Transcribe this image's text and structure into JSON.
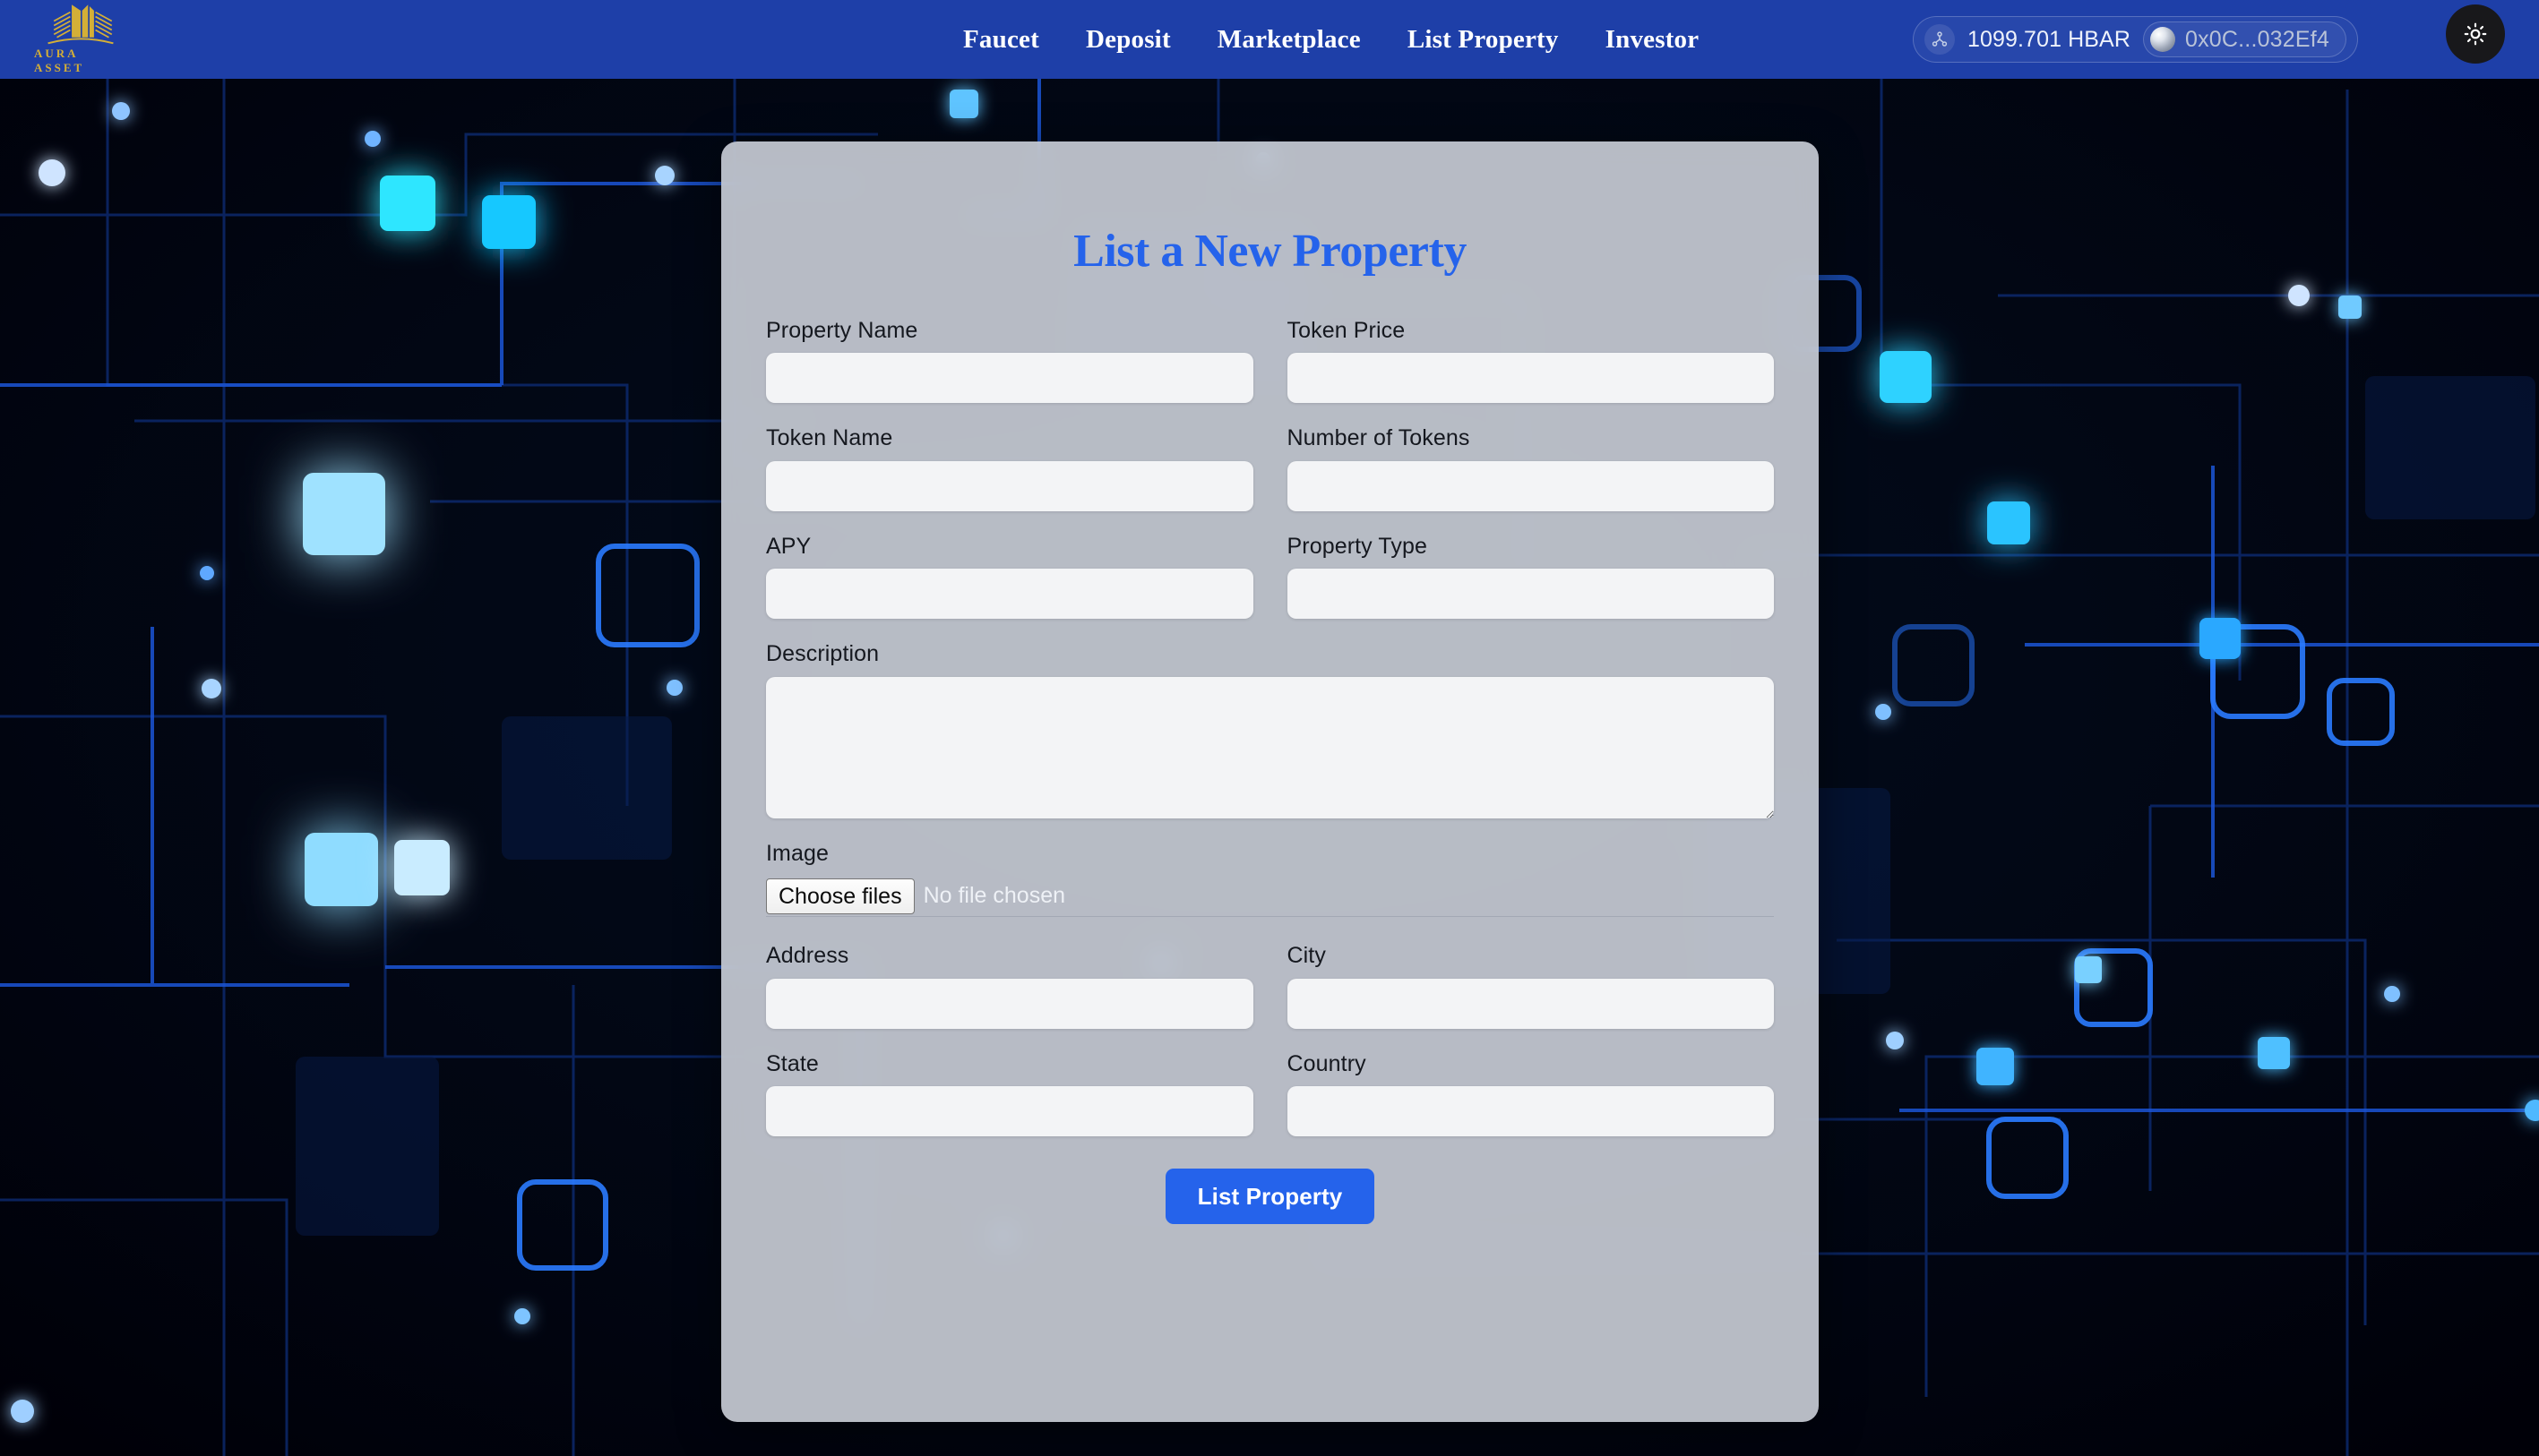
{
  "brand": {
    "name": "AURA ASSET",
    "logo_icon": "building-towers-logo",
    "logo_color": "#D4AF37"
  },
  "navbar": {
    "background_color": "#1E3FA8",
    "links": [
      {
        "label": "Faucet",
        "name": "nav-link-faucet"
      },
      {
        "label": "Deposit",
        "name": "nav-link-deposit"
      },
      {
        "label": "Marketplace",
        "name": "nav-link-marketplace"
      },
      {
        "label": "List Property",
        "name": "nav-link-list-property"
      },
      {
        "label": "Investor",
        "name": "nav-link-investor"
      }
    ],
    "wallet": {
      "network_icon": "hbar-network-icon",
      "balance": "1099.701 HBAR",
      "avatar_icon": "wallet-avatar-sphere",
      "address": "0x0C...032Ef4"
    },
    "theme_toggle": {
      "icon": "sun-icon",
      "background_color": "#18181b"
    }
  },
  "card": {
    "title": "List a New Property",
    "title_color": "#2563eb",
    "background_color": "#CBCFD8",
    "fields": {
      "property_name": {
        "label": "Property Name",
        "value": "",
        "placeholder": ""
      },
      "token_price": {
        "label": "Token Price",
        "value": "",
        "placeholder": ""
      },
      "token_name": {
        "label": "Token Name",
        "value": "",
        "placeholder": ""
      },
      "number_of_tokens": {
        "label": "Number of Tokens",
        "value": "",
        "placeholder": ""
      },
      "apy": {
        "label": "APY",
        "value": "",
        "placeholder": ""
      },
      "property_type": {
        "label": "Property Type",
        "value": "",
        "placeholder": ""
      },
      "description": {
        "label": "Description",
        "value": "",
        "placeholder": ""
      },
      "image": {
        "label": "Image",
        "button_label": "Choose files",
        "status_text": "No file chosen"
      },
      "address": {
        "label": "Address",
        "value": "",
        "placeholder": ""
      },
      "city": {
        "label": "City",
        "value": "",
        "placeholder": ""
      },
      "state": {
        "label": "State",
        "value": "",
        "placeholder": ""
      },
      "country": {
        "label": "Country",
        "value": "",
        "placeholder": ""
      }
    },
    "submit": {
      "label": "List Property",
      "color": "#2563eb"
    }
  }
}
